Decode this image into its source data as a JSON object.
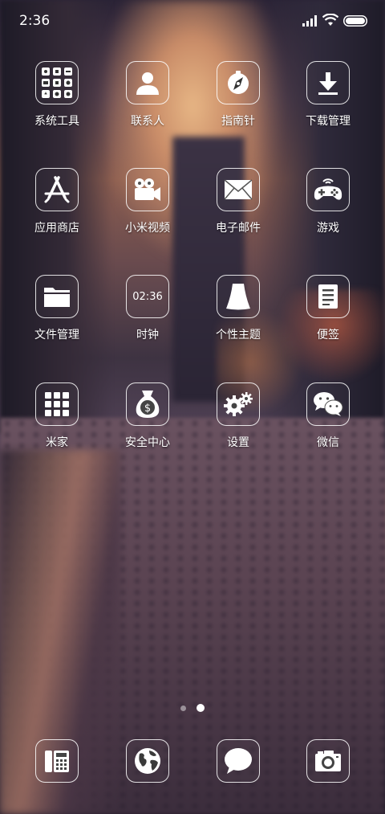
{
  "status_bar": {
    "time": "2:36"
  },
  "apps": [
    {
      "label": "系统工具",
      "icon": "system-tools-folder-icon"
    },
    {
      "label": "联系人",
      "icon": "contacts-icon"
    },
    {
      "label": "指南针",
      "icon": "compass-icon"
    },
    {
      "label": "下载管理",
      "icon": "download-icon"
    },
    {
      "label": "应用商店",
      "icon": "app-store-icon"
    },
    {
      "label": "小米视频",
      "icon": "video-camera-icon"
    },
    {
      "label": "电子邮件",
      "icon": "email-icon"
    },
    {
      "label": "游戏",
      "icon": "gamepad-icon"
    },
    {
      "label": "文件管理",
      "icon": "folder-icon"
    },
    {
      "label": "时钟",
      "icon": "clock-icon",
      "display": "02:36"
    },
    {
      "label": "个性主题",
      "icon": "theme-icon"
    },
    {
      "label": "便签",
      "icon": "notes-icon"
    },
    {
      "label": "米家",
      "icon": "grid-icon"
    },
    {
      "label": "安全中心",
      "icon": "money-bag-icon"
    },
    {
      "label": "设置",
      "icon": "gears-icon"
    },
    {
      "label": "微信",
      "icon": "wechat-icon"
    }
  ],
  "page_indicator": {
    "count": 2,
    "active": 2
  },
  "dock": [
    {
      "icon": "phone-icon"
    },
    {
      "icon": "browser-globe-icon"
    },
    {
      "icon": "messages-icon"
    },
    {
      "icon": "camera-icon"
    }
  ]
}
